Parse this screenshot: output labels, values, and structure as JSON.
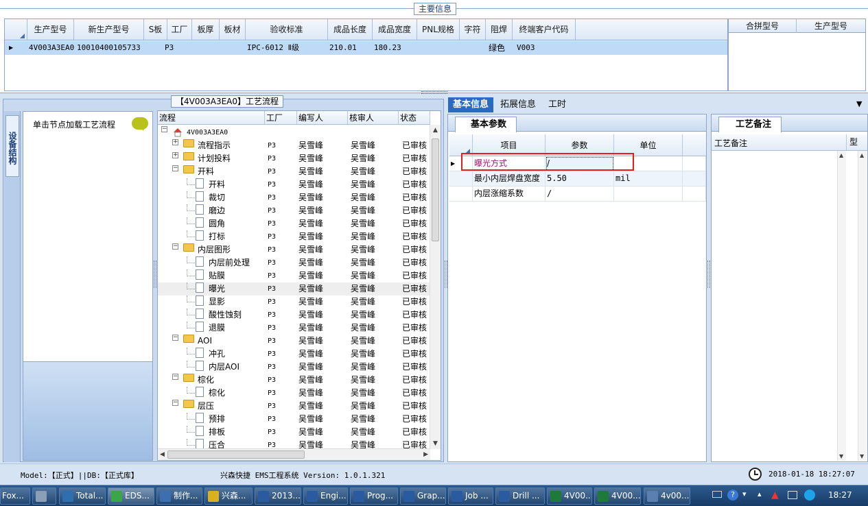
{
  "main": {
    "title": "主要信息",
    "columns": [
      "生产型号",
      "新生产型号",
      "S板",
      "工厂",
      "板厚",
      "板材",
      "验收标准",
      "成品长度",
      "成品宽度",
      "PNL规格",
      "字符",
      "阻焊",
      "终端客户代码"
    ],
    "row": [
      "4V003A3EA0",
      "10010400105733",
      "",
      "P3",
      "",
      "",
      "IPC-6012 Ⅱ级",
      "210.01",
      "180.23",
      "",
      "",
      "绿色",
      "V003"
    ],
    "side_columns": [
      "合拼型号",
      "生产型号"
    ]
  },
  "left": {
    "vertical_tab": "设备结构",
    "hint": "单击节点加载工艺流程",
    "flow_title": "【4V003A3EA0】工艺流程",
    "tree_columns": [
      "流程",
      "工厂",
      "编写人",
      "核审人",
      "状态"
    ],
    "root": "4V003A3EA0",
    "rows": [
      {
        "name": "流程指示",
        "factory": "P3",
        "writer": "吴雪峰",
        "reviewer": "吴雪峰",
        "status": "已审核"
      },
      {
        "name": "计划投料",
        "factory": "P3",
        "writer": "吴雪峰",
        "reviewer": "吴雪峰",
        "status": "已审核"
      },
      {
        "name": "开料",
        "factory": "P3",
        "writer": "吴雪峰",
        "reviewer": "吴雪峰",
        "status": "已审核"
      },
      {
        "name": "开料",
        "factory": "P3",
        "writer": "吴雪峰",
        "reviewer": "吴雪峰",
        "status": "已审核"
      },
      {
        "name": "裁切",
        "factory": "P3",
        "writer": "吴雪峰",
        "reviewer": "吴雪峰",
        "status": "已审核"
      },
      {
        "name": "磨边",
        "factory": "P3",
        "writer": "吴雪峰",
        "reviewer": "吴雪峰",
        "status": "已审核"
      },
      {
        "name": "圆角",
        "factory": "P3",
        "writer": "吴雪峰",
        "reviewer": "吴雪峰",
        "status": "已审核"
      },
      {
        "name": "打标",
        "factory": "P3",
        "writer": "吴雪峰",
        "reviewer": "吴雪峰",
        "status": "已审核"
      },
      {
        "name": "内层图形",
        "factory": "P3",
        "writer": "吴雪峰",
        "reviewer": "吴雪峰",
        "status": "已审核"
      },
      {
        "name": "内层前处理",
        "factory": "P3",
        "writer": "吴雪峰",
        "reviewer": "吴雪峰",
        "status": "已审核"
      },
      {
        "name": "贴膜",
        "factory": "P3",
        "writer": "吴雪峰",
        "reviewer": "吴雪峰",
        "status": "已审核"
      },
      {
        "name": "曝光",
        "factory": "P3",
        "writer": "吴雪峰",
        "reviewer": "吴雪峰",
        "status": "已审核"
      },
      {
        "name": "显影",
        "factory": "P3",
        "writer": "吴雪峰",
        "reviewer": "吴雪峰",
        "status": "已审核"
      },
      {
        "name": "酸性蚀刻",
        "factory": "P3",
        "writer": "吴雪峰",
        "reviewer": "吴雪峰",
        "status": "已审核"
      },
      {
        "name": "退膜",
        "factory": "P3",
        "writer": "吴雪峰",
        "reviewer": "吴雪峰",
        "status": "已审核"
      },
      {
        "name": "AOI",
        "factory": "P3",
        "writer": "吴雪峰",
        "reviewer": "吴雪峰",
        "status": "已审核"
      },
      {
        "name": "冲孔",
        "factory": "P3",
        "writer": "吴雪峰",
        "reviewer": "吴雪峰",
        "status": "已审核"
      },
      {
        "name": "内层AOI",
        "factory": "P3",
        "writer": "吴雪峰",
        "reviewer": "吴雪峰",
        "status": "已审核"
      },
      {
        "name": "棕化",
        "factory": "P3",
        "writer": "吴雪峰",
        "reviewer": "吴雪峰",
        "status": "已审核"
      },
      {
        "name": "棕化",
        "factory": "P3",
        "writer": "吴雪峰",
        "reviewer": "吴雪峰",
        "status": "已审核"
      },
      {
        "name": "层压",
        "factory": "P3",
        "writer": "吴雪峰",
        "reviewer": "吴雪峰",
        "status": "已审核"
      },
      {
        "name": "预排",
        "factory": "P3",
        "writer": "吴雪峰",
        "reviewer": "吴雪峰",
        "status": "已审核"
      },
      {
        "name": "排板",
        "factory": "P3",
        "writer": "吴雪峰",
        "reviewer": "吴雪峰",
        "status": "已审核"
      },
      {
        "name": "压合",
        "factory": "P3",
        "writer": "吴雪峰",
        "reviewer": "吴雪峰",
        "status": "已审核"
      }
    ]
  },
  "right": {
    "tabs": [
      "基本信息",
      "拓展信息",
      "工时"
    ],
    "sub_tab": "基本参数",
    "param_columns": [
      "项目",
      "参数",
      "单位"
    ],
    "params": [
      {
        "item": "曝光方式",
        "value": "/",
        "unit": ""
      },
      {
        "item": "最小内层焊盘宽度",
        "value": "5.50",
        "unit": "mil"
      },
      {
        "item": "内层涨缩系数",
        "value": "/",
        "unit": ""
      }
    ],
    "notes_tab": "工艺备注",
    "notes_columns": [
      "工艺备注",
      "型"
    ]
  },
  "status": {
    "model": "Model:【正式】||DB:【正式库】",
    "system": "兴森快捷 EMS工程系统 Version: 1.0.1.321",
    "datetime": "2018-01-18 18:27:07"
  },
  "taskbar": {
    "items": [
      "Fox...",
      "",
      "Total...",
      "EDS...",
      "制作...",
      "兴森...",
      "2013...",
      "Engi...",
      "Prog...",
      "Grap...",
      "Job ...",
      "Drill ...",
      "4V00...",
      "4V00...",
      "4v00..."
    ],
    "time": "18:27"
  },
  "colors": {
    "accent": "#2b6ac0",
    "selection": "#bfdaf6",
    "highlight_border": "#e02020",
    "item_text": "#9a1a6a"
  }
}
